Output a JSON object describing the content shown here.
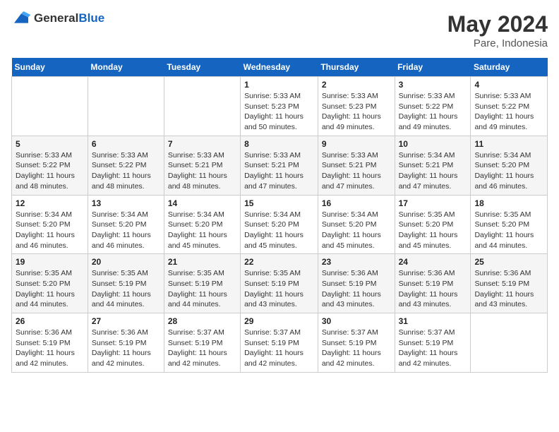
{
  "logo": {
    "general": "General",
    "blue": "Blue"
  },
  "header": {
    "month_year": "May 2024",
    "location": "Pare, Indonesia"
  },
  "weekdays": [
    "Sunday",
    "Monday",
    "Tuesday",
    "Wednesday",
    "Thursday",
    "Friday",
    "Saturday"
  ],
  "weeks": [
    [
      {
        "day": "",
        "sunrise": "",
        "sunset": "",
        "daylight": ""
      },
      {
        "day": "",
        "sunrise": "",
        "sunset": "",
        "daylight": ""
      },
      {
        "day": "",
        "sunrise": "",
        "sunset": "",
        "daylight": ""
      },
      {
        "day": "1",
        "sunrise": "Sunrise: 5:33 AM",
        "sunset": "Sunset: 5:23 PM",
        "daylight": "Daylight: 11 hours and 50 minutes."
      },
      {
        "day": "2",
        "sunrise": "Sunrise: 5:33 AM",
        "sunset": "Sunset: 5:23 PM",
        "daylight": "Daylight: 11 hours and 49 minutes."
      },
      {
        "day": "3",
        "sunrise": "Sunrise: 5:33 AM",
        "sunset": "Sunset: 5:22 PM",
        "daylight": "Daylight: 11 hours and 49 minutes."
      },
      {
        "day": "4",
        "sunrise": "Sunrise: 5:33 AM",
        "sunset": "Sunset: 5:22 PM",
        "daylight": "Daylight: 11 hours and 49 minutes."
      }
    ],
    [
      {
        "day": "5",
        "sunrise": "Sunrise: 5:33 AM",
        "sunset": "Sunset: 5:22 PM",
        "daylight": "Daylight: 11 hours and 48 minutes."
      },
      {
        "day": "6",
        "sunrise": "Sunrise: 5:33 AM",
        "sunset": "Sunset: 5:22 PM",
        "daylight": "Daylight: 11 hours and 48 minutes."
      },
      {
        "day": "7",
        "sunrise": "Sunrise: 5:33 AM",
        "sunset": "Sunset: 5:21 PM",
        "daylight": "Daylight: 11 hours and 48 minutes."
      },
      {
        "day": "8",
        "sunrise": "Sunrise: 5:33 AM",
        "sunset": "Sunset: 5:21 PM",
        "daylight": "Daylight: 11 hours and 47 minutes."
      },
      {
        "day": "9",
        "sunrise": "Sunrise: 5:33 AM",
        "sunset": "Sunset: 5:21 PM",
        "daylight": "Daylight: 11 hours and 47 minutes."
      },
      {
        "day": "10",
        "sunrise": "Sunrise: 5:34 AM",
        "sunset": "Sunset: 5:21 PM",
        "daylight": "Daylight: 11 hours and 47 minutes."
      },
      {
        "day": "11",
        "sunrise": "Sunrise: 5:34 AM",
        "sunset": "Sunset: 5:20 PM",
        "daylight": "Daylight: 11 hours and 46 minutes."
      }
    ],
    [
      {
        "day": "12",
        "sunrise": "Sunrise: 5:34 AM",
        "sunset": "Sunset: 5:20 PM",
        "daylight": "Daylight: 11 hours and 46 minutes."
      },
      {
        "day": "13",
        "sunrise": "Sunrise: 5:34 AM",
        "sunset": "Sunset: 5:20 PM",
        "daylight": "Daylight: 11 hours and 46 minutes."
      },
      {
        "day": "14",
        "sunrise": "Sunrise: 5:34 AM",
        "sunset": "Sunset: 5:20 PM",
        "daylight": "Daylight: 11 hours and 45 minutes."
      },
      {
        "day": "15",
        "sunrise": "Sunrise: 5:34 AM",
        "sunset": "Sunset: 5:20 PM",
        "daylight": "Daylight: 11 hours and 45 minutes."
      },
      {
        "day": "16",
        "sunrise": "Sunrise: 5:34 AM",
        "sunset": "Sunset: 5:20 PM",
        "daylight": "Daylight: 11 hours and 45 minutes."
      },
      {
        "day": "17",
        "sunrise": "Sunrise: 5:35 AM",
        "sunset": "Sunset: 5:20 PM",
        "daylight": "Daylight: 11 hours and 45 minutes."
      },
      {
        "day": "18",
        "sunrise": "Sunrise: 5:35 AM",
        "sunset": "Sunset: 5:20 PM",
        "daylight": "Daylight: 11 hours and 44 minutes."
      }
    ],
    [
      {
        "day": "19",
        "sunrise": "Sunrise: 5:35 AM",
        "sunset": "Sunset: 5:20 PM",
        "daylight": "Daylight: 11 hours and 44 minutes."
      },
      {
        "day": "20",
        "sunrise": "Sunrise: 5:35 AM",
        "sunset": "Sunset: 5:19 PM",
        "daylight": "Daylight: 11 hours and 44 minutes."
      },
      {
        "day": "21",
        "sunrise": "Sunrise: 5:35 AM",
        "sunset": "Sunset: 5:19 PM",
        "daylight": "Daylight: 11 hours and 44 minutes."
      },
      {
        "day": "22",
        "sunrise": "Sunrise: 5:35 AM",
        "sunset": "Sunset: 5:19 PM",
        "daylight": "Daylight: 11 hours and 43 minutes."
      },
      {
        "day": "23",
        "sunrise": "Sunrise: 5:36 AM",
        "sunset": "Sunset: 5:19 PM",
        "daylight": "Daylight: 11 hours and 43 minutes."
      },
      {
        "day": "24",
        "sunrise": "Sunrise: 5:36 AM",
        "sunset": "Sunset: 5:19 PM",
        "daylight": "Daylight: 11 hours and 43 minutes."
      },
      {
        "day": "25",
        "sunrise": "Sunrise: 5:36 AM",
        "sunset": "Sunset: 5:19 PM",
        "daylight": "Daylight: 11 hours and 43 minutes."
      }
    ],
    [
      {
        "day": "26",
        "sunrise": "Sunrise: 5:36 AM",
        "sunset": "Sunset: 5:19 PM",
        "daylight": "Daylight: 11 hours and 42 minutes."
      },
      {
        "day": "27",
        "sunrise": "Sunrise: 5:36 AM",
        "sunset": "Sunset: 5:19 PM",
        "daylight": "Daylight: 11 hours and 42 minutes."
      },
      {
        "day": "28",
        "sunrise": "Sunrise: 5:37 AM",
        "sunset": "Sunset: 5:19 PM",
        "daylight": "Daylight: 11 hours and 42 minutes."
      },
      {
        "day": "29",
        "sunrise": "Sunrise: 5:37 AM",
        "sunset": "Sunset: 5:19 PM",
        "daylight": "Daylight: 11 hours and 42 minutes."
      },
      {
        "day": "30",
        "sunrise": "Sunrise: 5:37 AM",
        "sunset": "Sunset: 5:19 PM",
        "daylight": "Daylight: 11 hours and 42 minutes."
      },
      {
        "day": "31",
        "sunrise": "Sunrise: 5:37 AM",
        "sunset": "Sunset: 5:19 PM",
        "daylight": "Daylight: 11 hours and 42 minutes."
      },
      {
        "day": "",
        "sunrise": "",
        "sunset": "",
        "daylight": ""
      }
    ]
  ]
}
